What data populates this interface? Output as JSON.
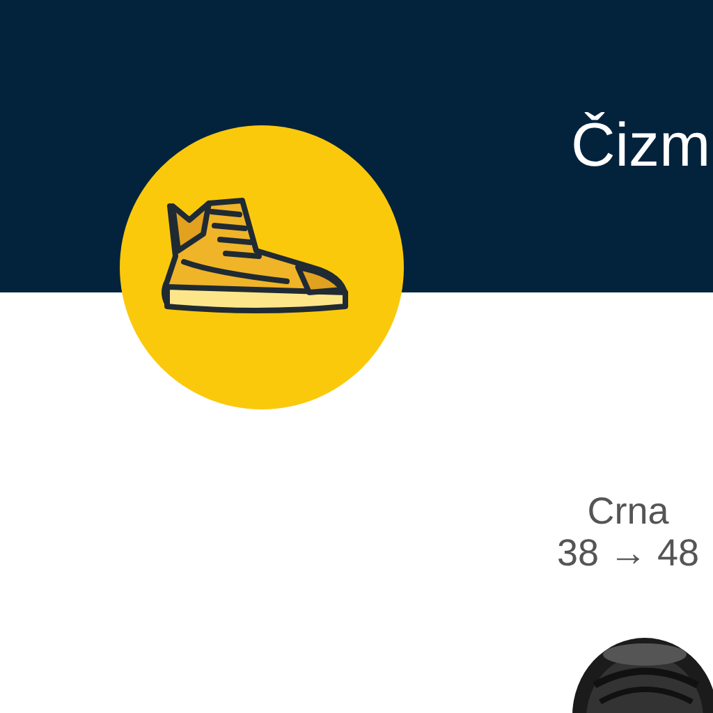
{
  "header": {
    "title": "Čizm"
  },
  "product": {
    "variant": "Crna",
    "sizes": "38 → 48"
  }
}
